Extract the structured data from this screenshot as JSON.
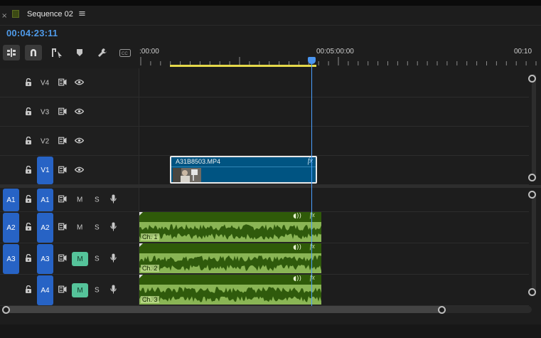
{
  "tab": {
    "close_glyph": "×",
    "title": "Sequence 02",
    "menu_glyph": "≡",
    "label_color": "#3c4a14"
  },
  "timecode": "00:04:23:11",
  "toolbar": [
    {
      "name": "insert-overwrite-icon"
    },
    {
      "name": "snap-magnet-icon",
      "active": true
    },
    {
      "name": "linked-selection-icon"
    },
    {
      "name": "add-marker-icon"
    },
    {
      "name": "wrench-settings-icon"
    },
    {
      "name": "captions-icon"
    }
  ],
  "ruler": {
    "labels": [
      ":00:00",
      "00:05:00:00",
      "00:10"
    ]
  },
  "video_tracks": [
    {
      "label": "V4",
      "source": ""
    },
    {
      "label": "V3",
      "source": ""
    },
    {
      "label": "V2",
      "source": ""
    },
    {
      "label": "V1",
      "source": "V1"
    }
  ],
  "audio_tracks": [
    {
      "source": "A1",
      "label": "A1",
      "mute": "M",
      "solo": "S",
      "mute_active": false
    },
    {
      "source": "A2",
      "label": "A2",
      "mute": "M",
      "solo": "S",
      "mute_active": false
    },
    {
      "source": "A3",
      "label": "A3",
      "mute": "M",
      "solo": "S",
      "mute_active": true
    },
    {
      "source": "",
      "label": "A4",
      "mute": "M",
      "solo": "S",
      "mute_active": true
    }
  ],
  "video_clip": {
    "name": "A31B8503.MP4",
    "fx": "fx",
    "color": "#005482"
  },
  "audio_clips": [
    {
      "channel": "Ch. 1",
      "fx": "fx"
    },
    {
      "channel": "Ch. 2",
      "fx": "fx"
    },
    {
      "channel": "Ch. 3",
      "fx": "fx"
    }
  ],
  "colors": {
    "accent_blue": "#2763c5",
    "audio_clip": "#8ab555",
    "playhead": "#4aa0ff",
    "work_area": "#e5d84a",
    "mute_active": "#55c39a"
  }
}
